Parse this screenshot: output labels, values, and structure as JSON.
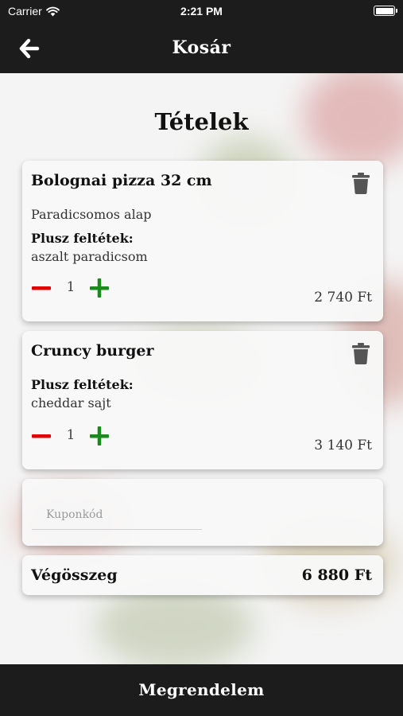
{
  "status": {
    "carrier": "Carrier",
    "time": "2:21 PM"
  },
  "nav": {
    "title": "Kosár"
  },
  "main": {
    "heading": "Tételek",
    "items": [
      {
        "name": "Bolognai pizza 32 cm",
        "base": "Paradicsomos alap",
        "extras_title": "Plusz feltétek:",
        "extras": "aszalt paradicsom",
        "quantity": "1",
        "price": "2 740 Ft"
      },
      {
        "name": "Cruncy burger",
        "extras_title": "Plusz feltétek:",
        "extras": "cheddar sajt",
        "quantity": "1",
        "price": "3 140 Ft"
      }
    ],
    "coupon": {
      "placeholder": "Kuponkód"
    },
    "total": {
      "label": "Végösszeg",
      "value": "6 880 Ft"
    }
  },
  "footer": {
    "order_label": "Megrendelem"
  },
  "colors": {
    "bar": "#1c1c1c",
    "minus": "#e10000",
    "plus": "#1a8a1a",
    "trash": "#555555"
  },
  "icons": [
    "wifi-icon",
    "battery-icon",
    "back-arrow-icon",
    "trash-icon",
    "minus-icon",
    "plus-icon"
  ]
}
